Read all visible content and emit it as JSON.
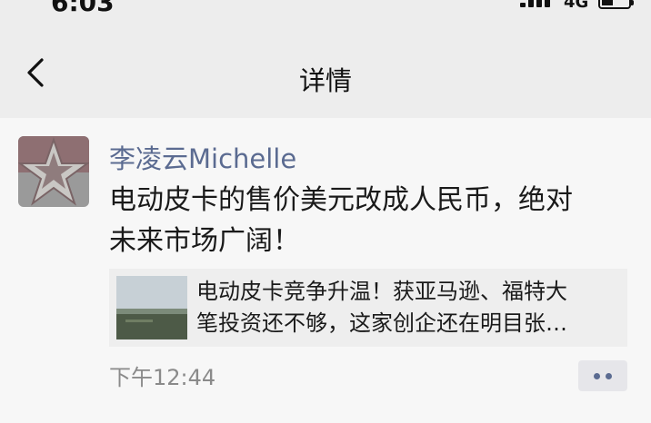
{
  "status_bar": {
    "time": "6:03",
    "network": "4G",
    "icons": [
      "signal-icon",
      "battery-icon"
    ]
  },
  "nav": {
    "back_icon": "back-arrow-icon",
    "title": "详情"
  },
  "post": {
    "author": "李凌云Michelle",
    "text_line1": "电动皮卡的售价美元改成人民币，绝对",
    "text_line2": "未来市场广阔！",
    "link": {
      "title_line1": "电动皮卡竞争升温！获亚马逊、福特大",
      "title_line2": "笔投资还不够，这家创企还在明目张…"
    },
    "time": "下午12:44",
    "more_icon": "more-dots-icon"
  },
  "colors": {
    "nickname": "#5b6b91",
    "background": "#ededed",
    "card": "#eeeeee"
  }
}
